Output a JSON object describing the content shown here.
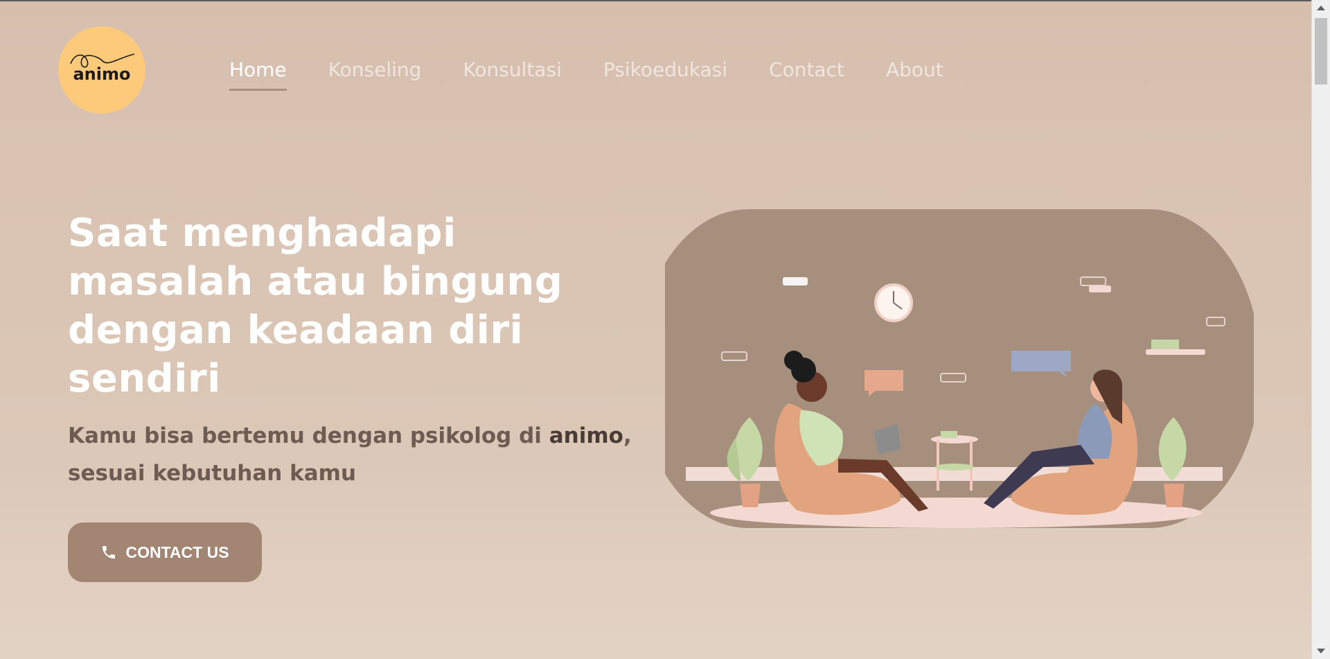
{
  "logo": {
    "text": "animo",
    "icon": "swirl-line"
  },
  "nav": {
    "items": [
      {
        "label": "Home",
        "active": true
      },
      {
        "label": "Konseling"
      },
      {
        "label": "Konsultasi"
      },
      {
        "label": "Psikoedukasi"
      },
      {
        "label": "Contact"
      },
      {
        "label": "About"
      }
    ]
  },
  "hero": {
    "headline": "Saat menghadapi masalah atau bingung dengan keadaan diri sendiri",
    "subtitle_before": "Kamu bisa bertemu dengan psikolog di ",
    "subtitle_brand": "animo",
    "subtitle_after": ", sesuai kebutuhan kamu",
    "cta_label": "CONTACT US",
    "cta_icon": "phone-icon"
  },
  "illustration": {
    "alt": "two-people-counseling-illustration"
  },
  "colors": {
    "background": "#d7bfae",
    "logo_bg": "#fdc97a",
    "cta_bg": "#a28572",
    "headline": "#ffffff",
    "subtitle": "#6e5b51",
    "nav_active_underline": "#a88f7d"
  }
}
